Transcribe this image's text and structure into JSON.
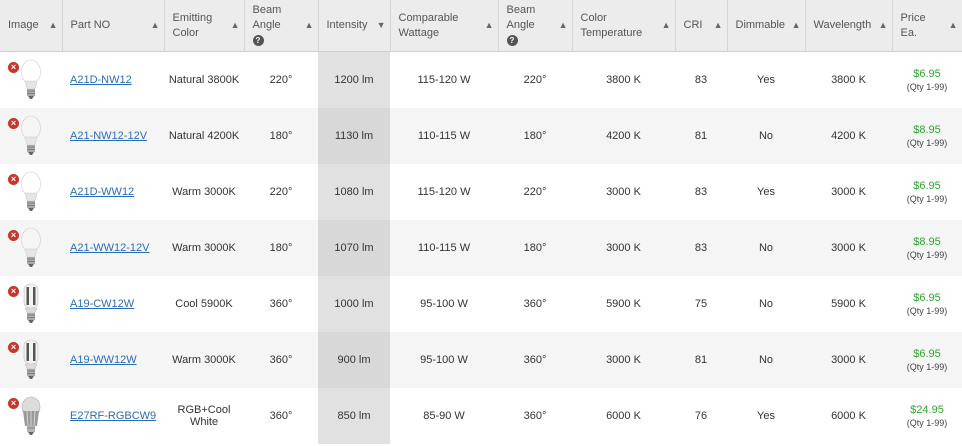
{
  "headers": [
    {
      "line1": "Image",
      "line2": "",
      "caret": "▲",
      "info": false
    },
    {
      "line1": "Part NO",
      "line2": "",
      "caret": "▲",
      "info": false
    },
    {
      "line1": "Emitting",
      "line2": "Color",
      "caret": "▲",
      "info": false
    },
    {
      "line1": "Beam",
      "line2": "Angle",
      "caret": "▲",
      "info": true
    },
    {
      "line1": "Intensity",
      "line2": "",
      "caret": "▼",
      "info": false
    },
    {
      "line1": "Comparable",
      "line2": "Wattage",
      "caret": "▲",
      "info": false
    },
    {
      "line1": "Beam",
      "line2": "Angle",
      "caret": "▲",
      "info": true
    },
    {
      "line1": "Color",
      "line2": "Temperature",
      "caret": "▲",
      "info": false
    },
    {
      "line1": "CRI",
      "line2": "",
      "caret": "▲",
      "info": false
    },
    {
      "line1": "Dimmable",
      "line2": "",
      "caret": "▲",
      "info": false
    },
    {
      "line1": "Wavelength",
      "line2": "",
      "caret": "▲",
      "info": false
    },
    {
      "line1": "Price",
      "line2": "Ea.",
      "caret": "▲",
      "info": false
    }
  ],
  "info_icon_glyph": "?",
  "remove_glyph": "×",
  "accent_colors": {
    "link": "#2b6cb5",
    "price": "#2ea52e",
    "remove": "#c0392b",
    "sorted_column": "#e1e1e1"
  },
  "rows": [
    {
      "bulb_icon": "a-bulb-icon",
      "part": "A21D-NW12",
      "emitting_color": "Natural 3800K",
      "beam_angle": "220°",
      "intensity": "1200 lm",
      "wattage": "115-120 W",
      "beam_angle_2": "220°",
      "color_temp": "3800 K",
      "cri": "83",
      "dimmable": "Yes",
      "wavelength": "3800 K",
      "price": "$6.95",
      "qty": "(Qty 1-99)"
    },
    {
      "bulb_icon": "a-bulb-icon",
      "part": "A21-NW12-12V",
      "emitting_color": "Natural 4200K",
      "beam_angle": "180°",
      "intensity": "1130 lm",
      "wattage": "110-115 W",
      "beam_angle_2": "180°",
      "color_temp": "4200 K",
      "cri": "81",
      "dimmable": "No",
      "wavelength": "4200 K",
      "price": "$8.95",
      "qty": "(Qty 1-99)"
    },
    {
      "bulb_icon": "a-bulb-icon",
      "part": "A21D-WW12",
      "emitting_color": "Warm 3000K",
      "beam_angle": "220°",
      "intensity": "1080 lm",
      "wattage": "115-120 W",
      "beam_angle_2": "220°",
      "color_temp": "3000 K",
      "cri": "83",
      "dimmable": "Yes",
      "wavelength": "3000 K",
      "price": "$6.95",
      "qty": "(Qty 1-99)"
    },
    {
      "bulb_icon": "a-bulb-icon",
      "part": "A21-WW12-12V",
      "emitting_color": "Warm 3000K",
      "beam_angle": "180°",
      "intensity": "1070 lm",
      "wattage": "110-115 W",
      "beam_angle_2": "180°",
      "color_temp": "3000 K",
      "cri": "83",
      "dimmable": "No",
      "wavelength": "3000 K",
      "price": "$8.95",
      "qty": "(Qty 1-99)"
    },
    {
      "bulb_icon": "corn-bulb-icon",
      "part": "A19-CW12W",
      "emitting_color": "Cool 5900K",
      "beam_angle": "360°",
      "intensity": "1000 lm",
      "wattage": "95-100 W",
      "beam_angle_2": "360°",
      "color_temp": "5900 K",
      "cri": "75",
      "dimmable": "No",
      "wavelength": "5900 K",
      "price": "$6.95",
      "qty": "(Qty 1-99)"
    },
    {
      "bulb_icon": "corn-bulb-icon",
      "part": "A19-WW12W",
      "emitting_color": "Warm 3000K",
      "beam_angle": "360°",
      "intensity": "900 lm",
      "wattage": "95-100 W",
      "beam_angle_2": "360°",
      "color_temp": "3000 K",
      "cri": "81",
      "dimmable": "No",
      "wavelength": "3000 K",
      "price": "$6.95",
      "qty": "(Qty 1-99)"
    },
    {
      "bulb_icon": "finned-bulb-icon",
      "part": "E27RF-RGBCW9",
      "emitting_color": "RGB+Cool White",
      "beam_angle": "360°",
      "intensity": "850 lm",
      "wattage": "85-90 W",
      "beam_angle_2": "360°",
      "color_temp": "6000 K",
      "cri": "76",
      "dimmable": "Yes",
      "wavelength": "6000 K",
      "price": "$24.95",
      "qty": "(Qty 1-99)"
    }
  ]
}
